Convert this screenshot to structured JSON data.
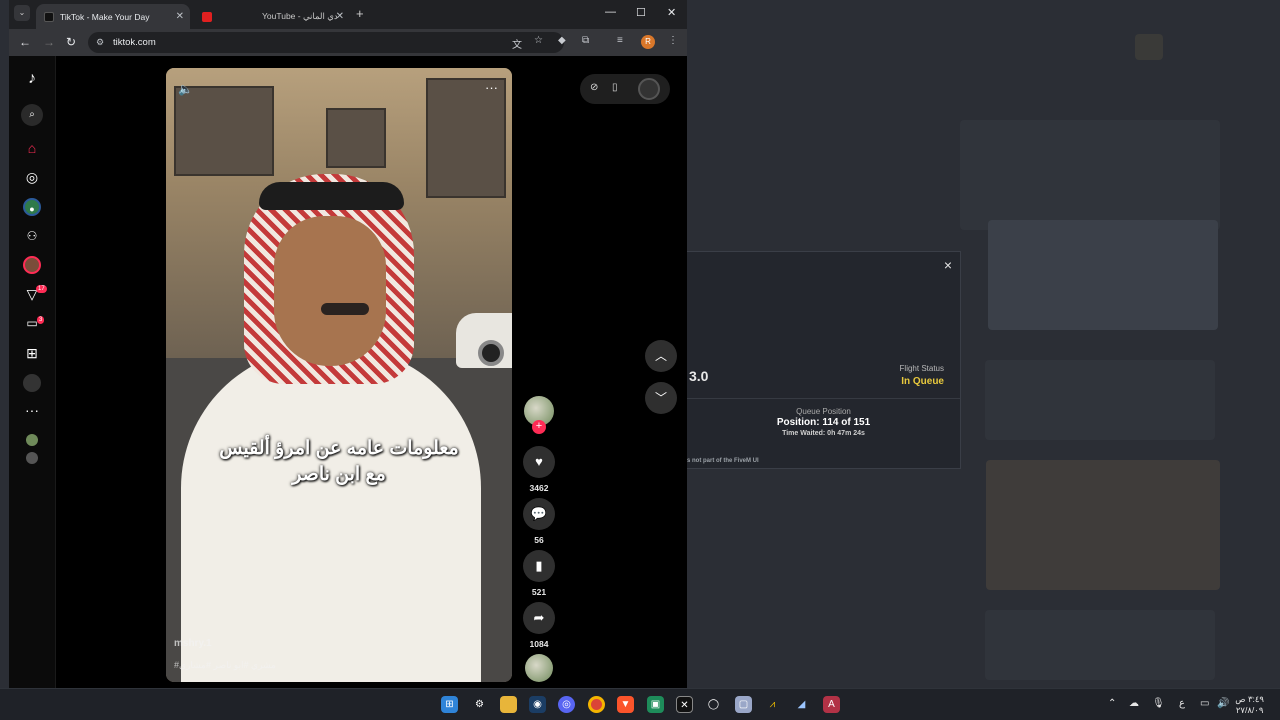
{
  "browser": {
    "tabs": [
      {
        "label": "TikTok - Make Your Day",
        "active": true
      },
      {
        "label": "YouTube - دي الماني",
        "active": false
      }
    ],
    "url": "tiktok.com",
    "profile_initial": "R"
  },
  "tiktok": {
    "nav_badges": {
      "activity": "17",
      "messages": "3"
    },
    "video": {
      "caption_line1": "معلومات عامه عن امرؤ ألقيس",
      "caption_line2": "مع ابن ناصر",
      "username_watermark": "mshry.1",
      "hashtags": "#مشري #ابو ناصر #مشاري"
    },
    "actions": {
      "likes": "3462",
      "comments": "56",
      "saves": "521",
      "shares": "1084"
    }
  },
  "launcher_dialog": {
    "close_label": "×",
    "version_fragment": "3.0",
    "flight_status_label": "Flight Status",
    "flight_status_value": "In Queue",
    "queue_label": "Queue Position",
    "queue_position": "Position: 114 of 151",
    "time_waited": "Time Waited: 0h 47m 24s",
    "disclaimer": "s not part of the FiveM UI"
  },
  "taskbar": {
    "lang": "ع",
    "time": "٣:٤٩ ص",
    "date": "٢٧/٨/٠٩"
  },
  "colors": {
    "tiktok_red": "#fe2c55",
    "queue_yellow": "#e8c93d"
  }
}
